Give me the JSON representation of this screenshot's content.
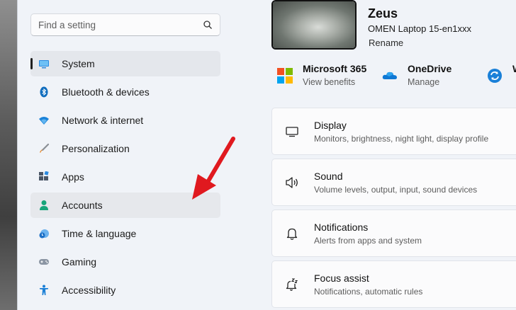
{
  "search": {
    "placeholder": "Find a setting"
  },
  "sidebar": {
    "items": [
      {
        "label": "System",
        "icon": "system-icon"
      },
      {
        "label": "Bluetooth & devices",
        "icon": "bluetooth-icon"
      },
      {
        "label": "Network & internet",
        "icon": "wifi-icon"
      },
      {
        "label": "Personalization",
        "icon": "brush-icon"
      },
      {
        "label": "Apps",
        "icon": "apps-icon"
      },
      {
        "label": "Accounts",
        "icon": "person-icon"
      },
      {
        "label": "Time & language",
        "icon": "clock-globe-icon"
      },
      {
        "label": "Gaming",
        "icon": "gamepad-icon"
      },
      {
        "label": "Accessibility",
        "icon": "accessibility-icon"
      }
    ],
    "selected_index": 0,
    "hovered_index": 5
  },
  "device": {
    "name": "Zeus",
    "model": "OMEN Laptop 15-en1xxx",
    "rename_label": "Rename"
  },
  "apps": [
    {
      "name": "Microsoft 365",
      "sub": "View benefits",
      "icon": "microsoft-logo-icon"
    },
    {
      "name": "OneDrive",
      "sub": "Manage",
      "icon": "onedrive-cloud-icon"
    },
    {
      "name": "W",
      "sub": "",
      "icon": "windows-update-icon"
    }
  ],
  "settings": [
    {
      "title": "Display",
      "sub": "Monitors, brightness, night light, display profile",
      "icon": "display-icon"
    },
    {
      "title": "Sound",
      "sub": "Volume levels, output, input, sound devices",
      "icon": "speaker-icon"
    },
    {
      "title": "Notifications",
      "sub": "Alerts from apps and system",
      "icon": "bell-icon"
    },
    {
      "title": "Focus assist",
      "sub": "Notifications, automatic rules",
      "icon": "bell-zz-icon"
    }
  ],
  "colors": {
    "accent": "#0067c0",
    "annotation_arrow": "#e0191f"
  }
}
